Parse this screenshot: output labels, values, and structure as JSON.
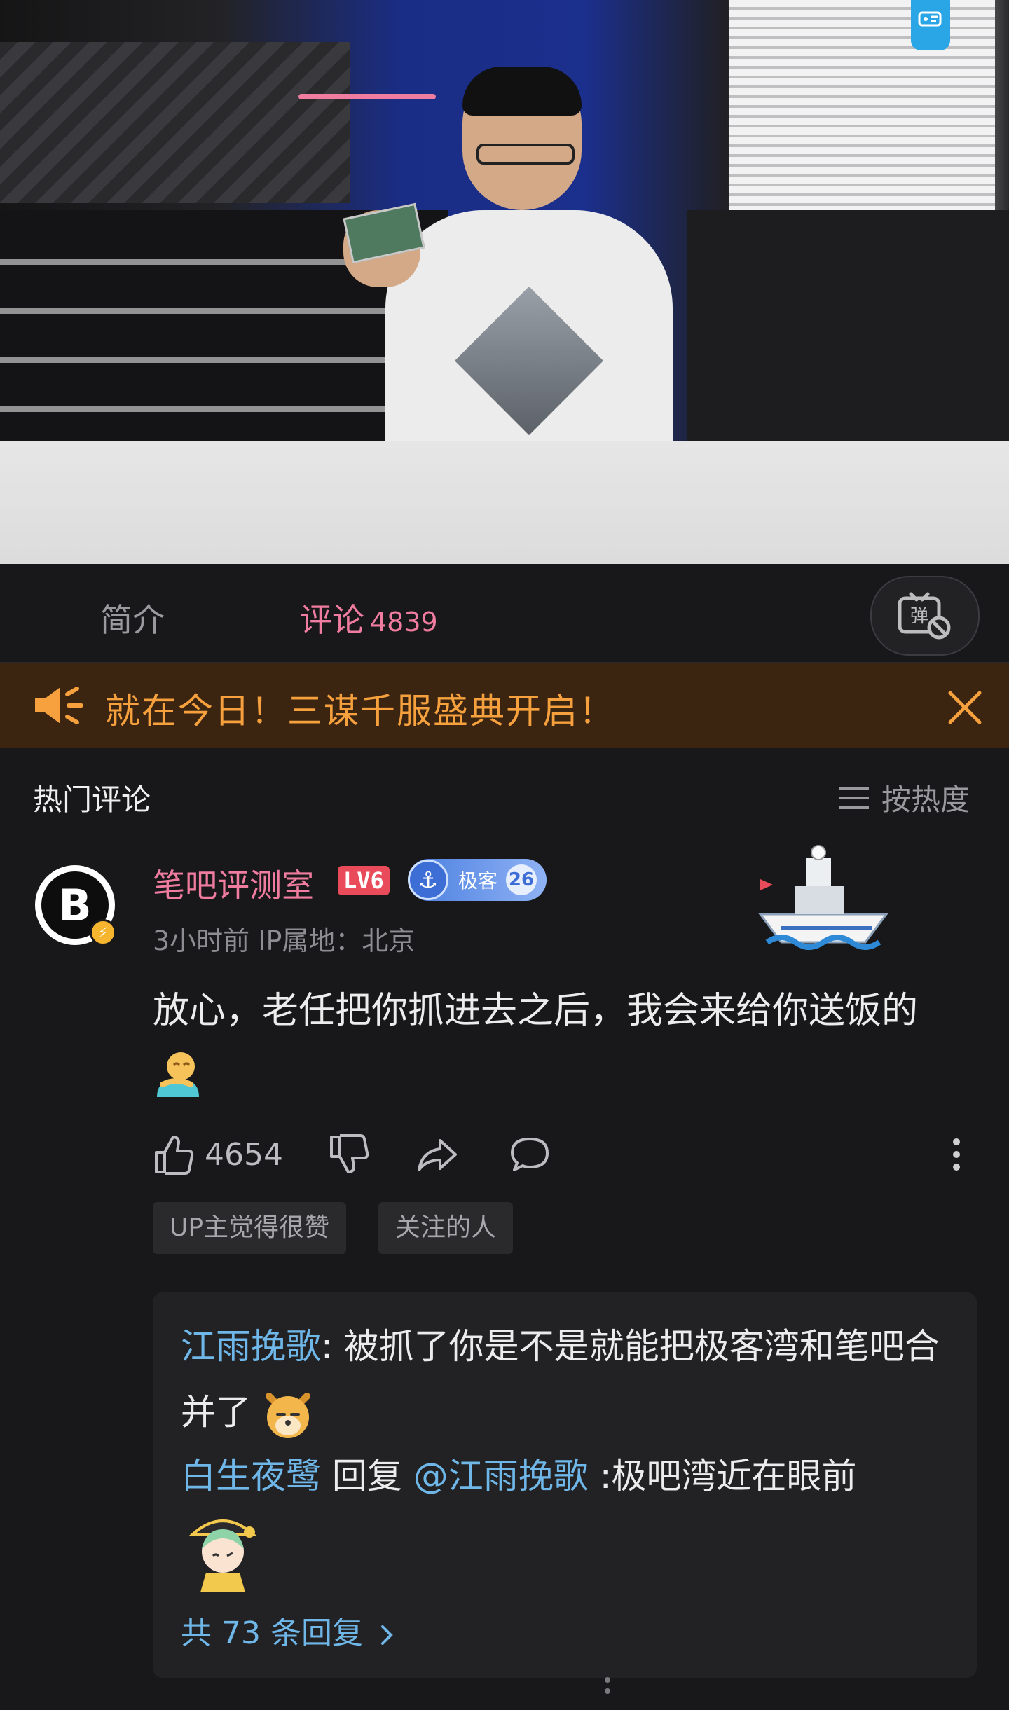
{
  "tabs": {
    "intro": "简介",
    "comments": "评论",
    "comment_count": "4839"
  },
  "banner": {
    "text": "就在今日！三谋千服盛典开启！",
    "icon": "speaker-icon",
    "close_icon": "close-icon"
  },
  "hot_comments": {
    "title": "热门评论",
    "sort_label": "按热度",
    "sort_icon": "menu-lines-icon"
  },
  "comment": {
    "username": "笔吧评测室",
    "level": "LV6",
    "fan_badge": {
      "name": "极客",
      "level": "26"
    },
    "meta": "3小时前 IP属地：北京",
    "text": "放心，老任把你抓进去之后，我会来给你送饭的",
    "likes": "4654",
    "tags": [
      "UP主觉得很赞",
      "关注的人"
    ]
  },
  "replies": [
    {
      "user": "江雨挽歌",
      "sep": ": ",
      "text": "被抓了你是不是就能把极客湾和笔吧合并了"
    },
    {
      "user": "白生夜鹭",
      "reply_word": " 回复 ",
      "mention": "@江雨挽歌",
      "text": " :极吧湾近在眼前"
    }
  ],
  "more_replies": "共 73 条回复",
  "colors": {
    "pink": "#f07ca0",
    "link_blue": "#6fb7e8",
    "banner_bg": "#3b2410",
    "banner_text": "#f6a13d",
    "bg": "#18181a"
  }
}
